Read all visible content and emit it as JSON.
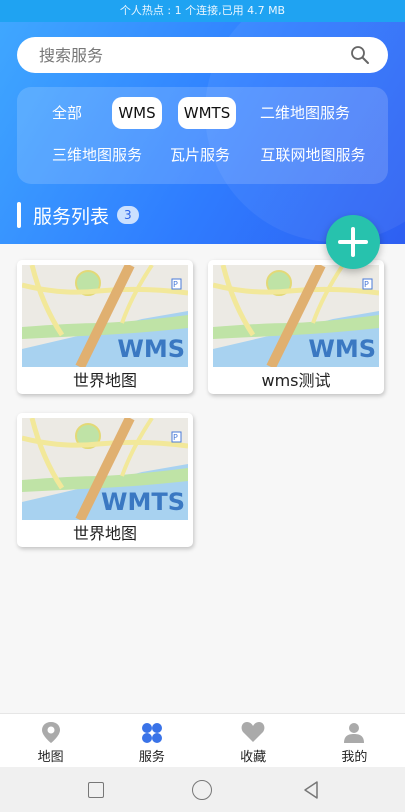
{
  "statusbar": {
    "text": "个人热点 : 1 个连接,已用 4.7 MB"
  },
  "search": {
    "placeholder": "搜索服务",
    "icon": "search-icon"
  },
  "filters": [
    {
      "label": "全部",
      "active": false
    },
    {
      "label": "WMS",
      "active": true
    },
    {
      "label": "WMTS",
      "active": true
    },
    {
      "label": "二维地图服务",
      "active": false
    },
    {
      "label": "三维地图服务",
      "active": false
    },
    {
      "label": "瓦片服务",
      "active": false
    },
    {
      "label": "互联网地图服务",
      "active": false
    }
  ],
  "section": {
    "title": "服务列表",
    "count": "3"
  },
  "fab": {
    "icon": "plus-icon"
  },
  "services": [
    {
      "name": "世界地图",
      "type": "WMS"
    },
    {
      "name": "wms测试",
      "type": "WMS"
    },
    {
      "name": "世界地图",
      "type": "WMTS"
    }
  ],
  "tabs": [
    {
      "label": "地图",
      "icon": "map-pin-icon",
      "active": false
    },
    {
      "label": "服务",
      "icon": "clover-icon",
      "active": true
    },
    {
      "label": "收藏",
      "icon": "heart-icon",
      "active": false
    },
    {
      "label": "我的",
      "icon": "user-icon",
      "active": false
    }
  ],
  "colors": {
    "accent": "#2f7dff",
    "fab": "#27c2ad",
    "active_tab": "#2f6bea"
  }
}
